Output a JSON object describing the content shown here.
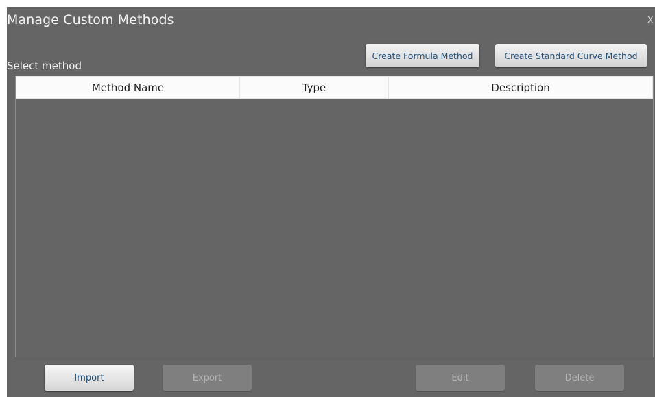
{
  "dialog": {
    "title": "Manage Custom Methods",
    "close_label": "X",
    "select_label": "Select method"
  },
  "toolbar": {
    "create_formula_label": "Create Formula Method",
    "create_standard_curve_label": "Create Standard Curve Method"
  },
  "table": {
    "columns": [
      "Method Name",
      "Type",
      "Description"
    ],
    "rows": []
  },
  "footer": {
    "import_label": "Import",
    "export_label": "Export",
    "edit_label": "Edit",
    "delete_label": "Delete",
    "disabled_buttons": [
      "Export",
      "Edit",
      "Delete"
    ]
  },
  "colors": {
    "dialog_bg": "#656565",
    "button_text": "#23547f",
    "disabled_button_bg": "#7f7f7f"
  }
}
